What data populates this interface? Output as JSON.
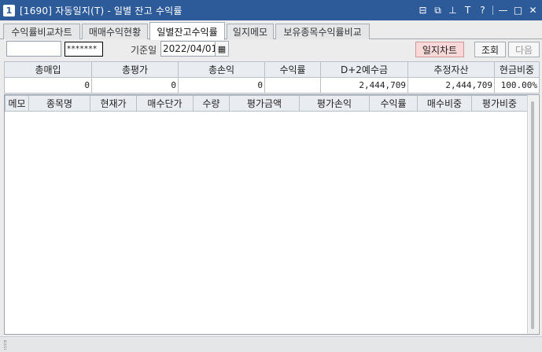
{
  "window": {
    "number": "1",
    "title": "[1690] 자동일지(T) - 일별 잔고 수익률"
  },
  "title_icons": [
    "window-layout-icon",
    "link-icon",
    "pin-icon",
    "font-size-icon",
    "help-icon",
    "minimize-icon",
    "maximize-icon",
    "close-icon"
  ],
  "title_icon_glyphs": {
    "layout": "⊟",
    "link": "⧉",
    "pin": "⊥",
    "font": "T",
    "help": "?",
    "minimize": "—",
    "maximize": "□",
    "close": "✕"
  },
  "tabs": [
    {
      "label": "수익률비교차트"
    },
    {
      "label": "매매수익현황"
    },
    {
      "label": "일별잔고수익률"
    },
    {
      "label": "일지메모"
    },
    {
      "label": "보유종목수익률비교"
    }
  ],
  "active_tab": 2,
  "toolbar": {
    "account_value": "",
    "password_value": "*******",
    "date_label": "기준일",
    "date_value": "2022/04/01",
    "calendar_glyph": "▦",
    "chart_button": "일지차트",
    "query_button": "조회",
    "next_button": "다음"
  },
  "summary": {
    "headers": [
      "총매입",
      "총평가",
      "총손익",
      "수익률",
      "D+2예수금",
      "추정자산",
      "현금비중"
    ],
    "values": [
      "0",
      "0",
      "0",
      "",
      "2,444,709",
      "2,444,709",
      "100.00%"
    ]
  },
  "grid": {
    "headers": [
      "메모",
      "종목명",
      "현재가",
      "매수단가",
      "수량",
      "평가금액",
      "평가손익",
      "수익률",
      "매수비중",
      "평가비중"
    ]
  },
  "colors": {
    "titlebar": "#2D5B9A",
    "chart_button_bg": "#F8D8D8",
    "header_bg": "#E9ECF0"
  }
}
